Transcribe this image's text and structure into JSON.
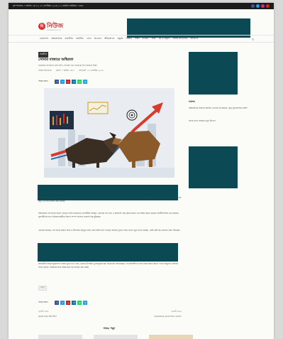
{
  "topbar": {
    "date": "বৃহস্পতিবার, ৭ আশ্বিন ১৪৩১ | ২২ সেপ্টেম্বর ২০২৪ | ১৩ রবিউল আউয়াল ১৪৪৬",
    "social": [
      {
        "name": "facebook-icon",
        "color": "#3b5998"
      },
      {
        "name": "twitter-icon",
        "color": "#1da1f2"
      },
      {
        "name": "instagram-icon",
        "color": "#c13584"
      },
      {
        "name": "youtube-icon",
        "color": "#e62117"
      }
    ]
  },
  "logo": {
    "mark": "দি",
    "name": "নিউজ",
    "sub": "DESHNEWS24.COM"
  },
  "nav": {
    "items": [
      "বাংলাদেশ",
      "আন্তর্জাতিক",
      "রাজনীতি",
      "অর্থনীতি",
      "খেলা",
      "বিনোদন",
      "জীবনযাপন",
      "প্রযুক্তি",
      "বিজ্ঞান",
      "শিক্ষা",
      "মতামত",
      "স্বাস্থ্য",
      "ধর্ম ও প্রকৃতি",
      "বিশেষ প্রতিবেদন",
      "আরো ▾"
    ]
  },
  "article": {
    "category": "অর্থনীতি",
    "headline": "সোনার বাজারে অস্থিরতা",
    "subhead": "সপ্তাহের ব্যবধানে ভরি প্রতি সোনার দাম বেড়েছে তিন হাজার টাকা",
    "author": "নিজস্ব প্রতিবেদক",
    "published": "প্রকাশ: ৭ আশ্বিন ১৪৩১",
    "updated": "আপডেট: ২২ সেপ্টেম্বর ২০২৪",
    "share_label": "শেয়ার করুন",
    "paragraphs": [
      "দেশের বাজারে সোনার দাম ফের বেড়েছে। প্রতি ভরি ২২ ক্যারেট সোনার দাম এখন এক লাখ ত্রিশ হাজার টাকা ছাড়িয়েছে। বাজুস জানিয়েছে, স্থানীয় বাজারে তেজাবী সোনার দাম বাড়ায় নতুন এই দাম নির্ধারণ করা হয়েছে।",
      "বিশ্ববাজারে দাম বাড়ার প্রভাব পড়েছে দেশের বাজারেও। ব্যবসায়ীরা বলছেন, ডলারের দাম বাড়া ও আমদানি খরচ বৃদ্ধির কারণে দাম সমন্বয় করতে হয়েছে। অর্থনীতিবিদরা মনে করছেন, মূল্যস্ফীতির চাপে বিনিয়োগকারীরা নিরাপদ সম্পদ হিসেবে সোনার দিকে ঝুঁকছেন।",
      "ক্রেতারা বলছেন, দাম বাড়ার কারণে বিয়ে ও উৎসবের মৌসুমে গহনা কেনা কঠিন হয়ে পড়েছে। অনেকে পুরনো গহনা বদলে নতুন গহনা নিচ্ছেন, কেউ কেউ কম ওজনের গহনা কিনছেন।",
      "রাজধানীর বিভিন্ন জুয়েলারি দোকান ঘুরে দেখা গেছে, ক্রেতার উপস্থিতি তুলনামূলক কম। বিক্রেতারা জানিয়েছেন, দাম স্থিতিশীল না হলে বিক্রি আরও কমতে পারে। বাজুসের একাধিক সদস্য জানান, সরকারের সঙ্গে সমন্বয় করে দাম নির্ধারণ করা হচ্ছে।"
    ],
    "tag": "সোনা"
  },
  "post_nav": {
    "prev_label": "পূর্ববর্তী সংবাদ",
    "prev_title": "রিজার্ভ বাড়ছে ধীরে ধীরে",
    "next_label": "পরবর্তী সংবাদ",
    "next_title": "শেয়ারবাজারে সূচকের উত্থান অব্যাহত"
  },
  "related": {
    "title": "আরও পড়ুন"
  },
  "sidebar": {
    "title": "সর্বশেষ",
    "items": [
      "আন্তর্জাতিক বাজারে জ্বালানি তেলের দাম কমেছে, নতুন মূল্যতালিকা প্রকাশ",
      "ব্যাংক খাতে সংস্কারে নতুন উদ্যোগ"
    ]
  },
  "colors": {
    "accent": "#d92b2b",
    "ad_block": "#0b4a55",
    "facebook": "#3b5998",
    "twitter": "#1da1f2",
    "pinterest": "#cb2027",
    "linkedin": "#0077b5",
    "whatsapp": "#25d366",
    "telegram": "#2ca5e0"
  }
}
